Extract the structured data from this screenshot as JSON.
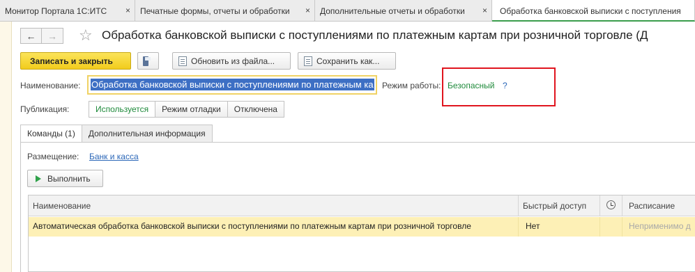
{
  "tabs": [
    {
      "label": "Монитор Портала 1С:ИТС",
      "close": "×"
    },
    {
      "label": "Печатные формы, отчеты и обработки",
      "close": "×"
    },
    {
      "label": "Дополнительные отчеты и обработки",
      "close": "×"
    },
    {
      "label": "Обработка банковской выписки с поступления",
      "close": ""
    }
  ],
  "header": {
    "back": "←",
    "forward": "→",
    "star": "☆",
    "title": "Обработка банковской выписки с поступлениями по платежным картам при розничной торговле (Д"
  },
  "toolbar": {
    "save_close": "Записать и закрыть",
    "update_from_file": "Обновить из файла...",
    "save_as": "Сохранить как..."
  },
  "form": {
    "name_label": "Наименование:",
    "name_value": "Обработка банковской выписки с поступлениями по платежным ка",
    "mode_label": "Режим работы:",
    "mode_value": "Безопасный",
    "help": "?",
    "publication_label": "Публикация:",
    "publication_options": [
      "Используется",
      "Режим отладки",
      "Отключена"
    ],
    "publication_selected": "Используется"
  },
  "inner_tabs": [
    "Команды (1)",
    "Дополнительная информация"
  ],
  "commands": {
    "placement_label": "Размещение:",
    "placement_value": "Банк и касса",
    "run_label": "Выполнить"
  },
  "grid": {
    "columns": [
      "Наименование",
      "Быстрый доступ",
      "clock-icon",
      "Расписание"
    ],
    "rows": [
      {
        "name": "Автоматическая обработка банковской выписки с поступлениями по платежным картам при розничной торговле",
        "quick_access": "Нет",
        "clock": "",
        "schedule": "Неприменимо д"
      }
    ]
  },
  "colors": {
    "accent_green": "#1f8a3b",
    "primary_button": "#f2cc1c",
    "selection": "#3d6fc4",
    "row_highlight": "#fdf0b6",
    "annotation_box": "#e0141e"
  }
}
